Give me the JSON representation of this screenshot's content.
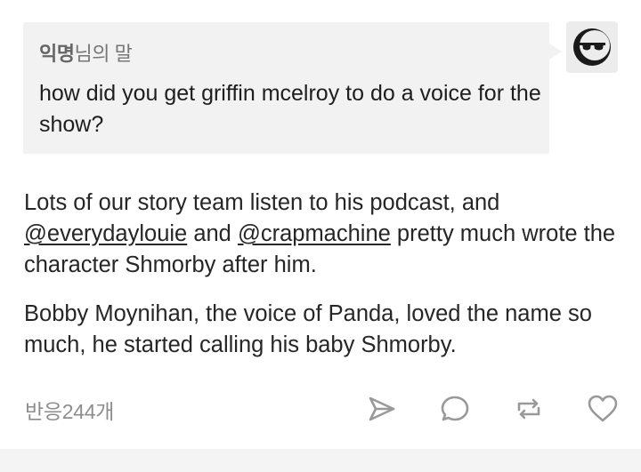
{
  "ask": {
    "asker_name": "익명",
    "asker_suffix": "님의 말",
    "question": "how did you get griffin mcelroy to do a voice for the show?"
  },
  "answer": {
    "para1_a": "Lots of our story team listen to his podcast, and",
    "mention1": "@everydaylouie",
    "and_word": " and ",
    "mention2": "@crapmachine",
    "para1_b": " pretty much wrote the character Shmorby after him.",
    "para2": "Bobby Moynihan, the voice of Panda, loved the name so much, he started calling his baby Shmorby."
  },
  "footer": {
    "notes_label": "반응244개",
    "icons": [
      "share-icon",
      "reply-icon",
      "reblog-icon",
      "like-icon"
    ],
    "icon_color": "#999999"
  },
  "colors": {
    "bubble_bg": "#f2f2f2",
    "text": "#262626",
    "muted": "#8d8d8d"
  }
}
